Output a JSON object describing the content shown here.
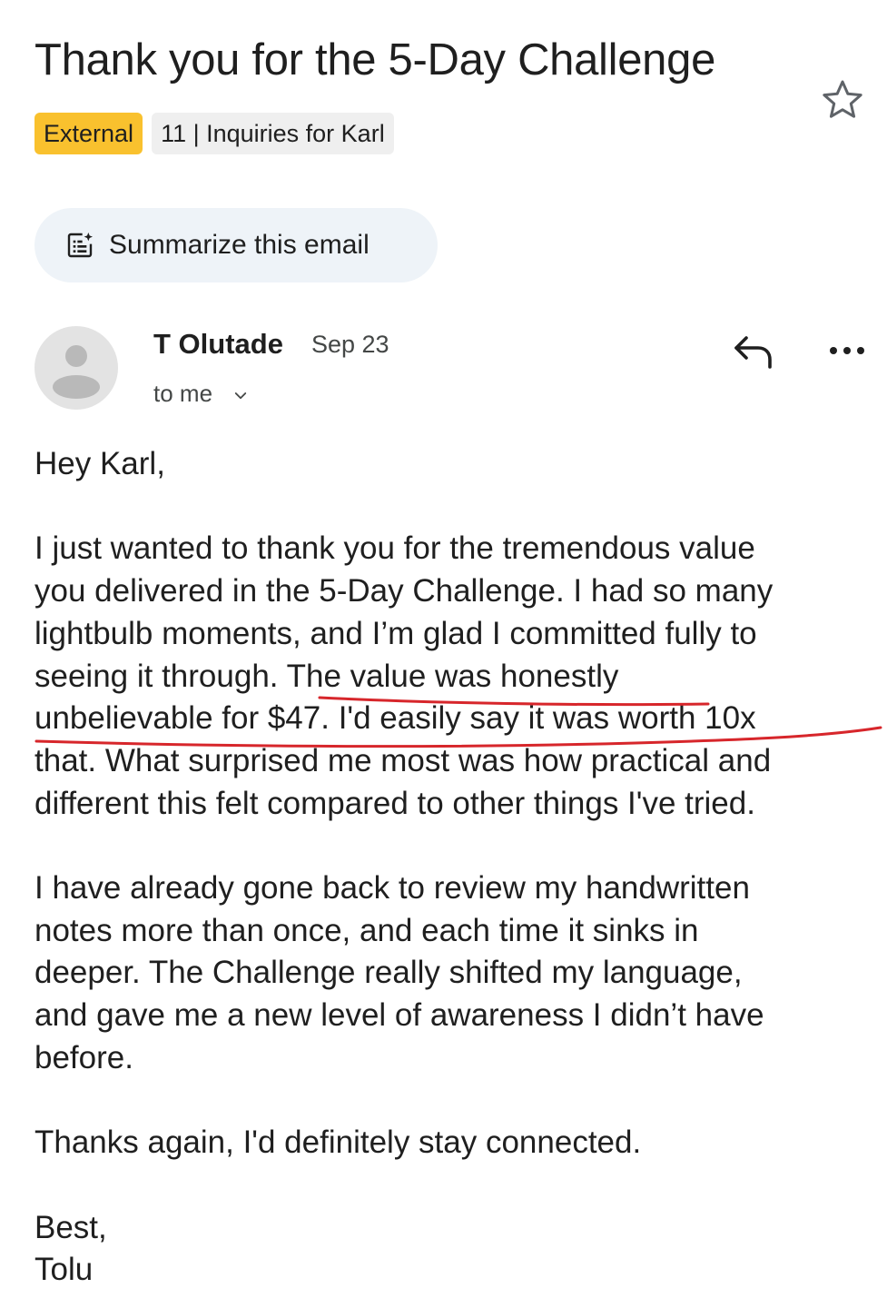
{
  "email": {
    "subject": "Thank you for the 5-Day Challenge",
    "labels": [
      "External",
      "11 | Inquiries for Karl"
    ],
    "summarize_label": "Summarize this email",
    "sender": "T Olutade",
    "date": "Sep 23",
    "recipient": "to me",
    "body": {
      "greeting": "Hey Karl,",
      "paragraph1": [
        "I just wanted to thank you for the tremendous value",
        "you delivered in the 5-Day Challenge. I had so many",
        "lightbulb moments, and I’m glad I committed fully to",
        "seeing it through. The value was honestly",
        "unbelievable for $47. I'd easily say it was worth 10x",
        "that. What surprised me most was how practical and",
        "different this felt compared to other things I've tried."
      ],
      "paragraph2": [
        "I have already gone back to review my handwritten",
        "notes more than once, and each time it sinks in",
        "deeper. The Challenge really shifted my language,",
        "and gave me a new level of awareness I didn’t have",
        "before."
      ],
      "closing_line": "Thanks again, I'd definitely stay connected.",
      "signoff": "Best,",
      "signature": "Tolu"
    }
  },
  "icons": {
    "star": "star-outline-icon",
    "summarize": "summarize-spark-icon",
    "avatar": "default-person-icon",
    "reply": "reply-arrow-icon",
    "more": "more-horizontal-icon",
    "expand": "chevron-down-icon"
  },
  "colors": {
    "external_chip": "#f9c12e",
    "folder_chip": "#efefef",
    "summarize_bg": "#eef3f8",
    "annotation": "#d7262b"
  }
}
